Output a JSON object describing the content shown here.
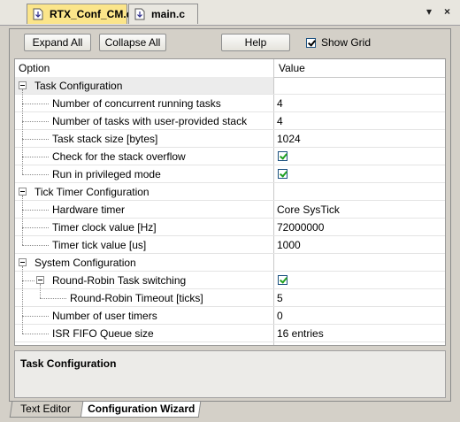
{
  "tabs": [
    {
      "label": "RTX_Conf_CM.c",
      "active": true
    },
    {
      "label": "main.c",
      "active": false
    }
  ],
  "tabbar_controls": {
    "pin_glyph": "▾",
    "close_glyph": "×"
  },
  "toolbar": {
    "expand_all": "Expand All",
    "collapse_all": "Collapse All",
    "help": "Help",
    "show_grid": "Show Grid",
    "show_grid_checked": true
  },
  "grid": {
    "header_option": "Option",
    "header_value": "Value",
    "rows": [
      {
        "label": "Task Configuration",
        "value": "",
        "type": "group",
        "level": 0
      },
      {
        "label": "Number of concurrent running tasks",
        "value": "4",
        "type": "text",
        "level": 1
      },
      {
        "label": "Number of tasks with user-provided stack",
        "value": "4",
        "type": "text",
        "level": 1
      },
      {
        "label": "Task stack size [bytes]",
        "value": "1024",
        "type": "text",
        "level": 1
      },
      {
        "label": "Check for the stack overflow",
        "value": "",
        "type": "checkbox",
        "checked": true,
        "level": 1
      },
      {
        "label": "Run in privileged mode",
        "value": "",
        "type": "checkbox",
        "checked": true,
        "level": 1
      },
      {
        "label": "Tick Timer Configuration",
        "value": "",
        "type": "group",
        "level": 0
      },
      {
        "label": "Hardware timer",
        "value": "Core SysTick",
        "type": "text",
        "level": 1
      },
      {
        "label": "Timer clock value [Hz]",
        "value": "72000000",
        "type": "text",
        "level": 1
      },
      {
        "label": "Timer tick value [us]",
        "value": "1000",
        "type": "text",
        "level": 1
      },
      {
        "label": "System Configuration",
        "value": "",
        "type": "group",
        "level": 0
      },
      {
        "label": "Round-Robin Task switching",
        "value": "",
        "type": "checkbox",
        "checked": true,
        "level": 1
      },
      {
        "label": "Round-Robin Timeout [ticks]",
        "value": "5",
        "type": "text",
        "level": 2
      },
      {
        "label": "Number of user timers",
        "value": "0",
        "type": "text",
        "level": 1
      },
      {
        "label": "ISR FIFO Queue size",
        "value": "16 entries",
        "type": "text",
        "level": 1
      }
    ]
  },
  "description": {
    "title": "Task Configuration"
  },
  "bottom_tabs": [
    {
      "label": "Text Editor",
      "active": false
    },
    {
      "label": "Configuration Wizard",
      "active": true
    }
  ]
}
